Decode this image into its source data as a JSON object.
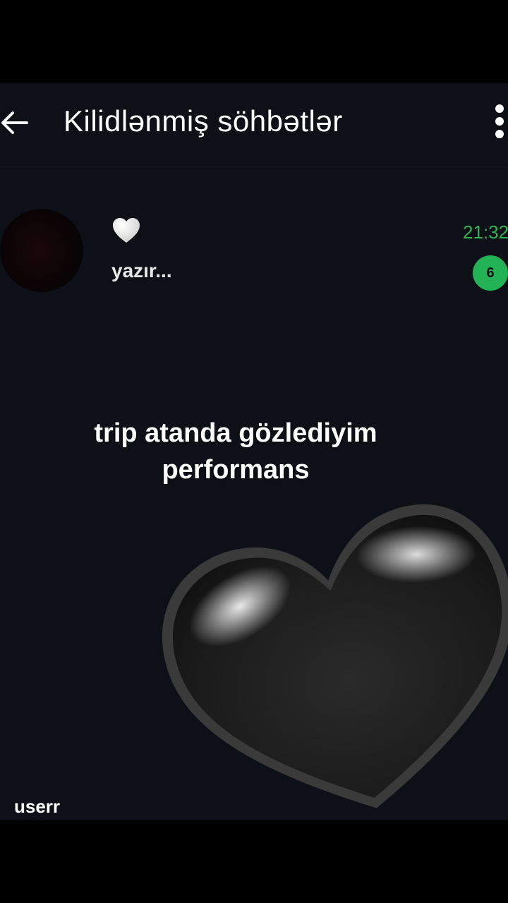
{
  "app_bar": {
    "title": "Kilidlənmiş söhbətlər",
    "back_icon": "arrow-left-icon",
    "menu_icon": "more-vertical-icon"
  },
  "chat": {
    "name_icon": "white-heart-emoji",
    "preview": "yazır...",
    "time": "21:32",
    "unread_count": "6",
    "accent_color": "#25b258"
  },
  "overlay": {
    "caption_line1": "trip atanda gözlediyim",
    "caption_line2": "performans",
    "sticker": "black-heart-emoji"
  },
  "watermark": {
    "username": "userr"
  },
  "colors": {
    "background": "#0d1117",
    "letterbox": "#000000",
    "text": "#ffffff"
  }
}
